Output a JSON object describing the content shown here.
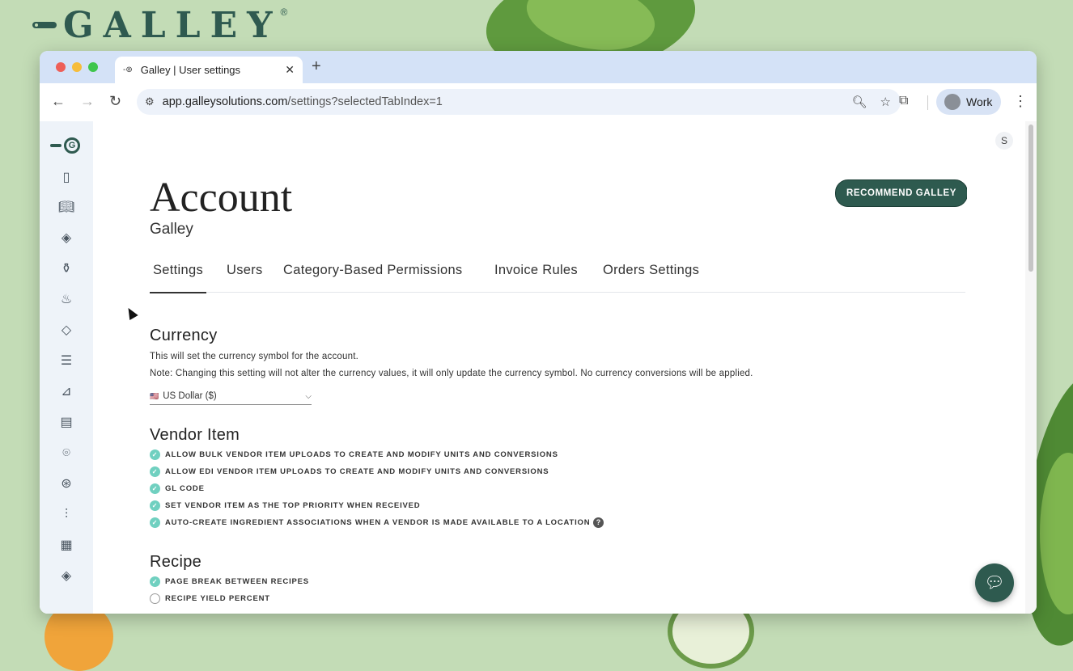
{
  "brand": {
    "name": "GALLEY",
    "reg": "®"
  },
  "browser": {
    "tab_title": "Galley | User settings",
    "url_host": "app.galleysolutions.com",
    "url_path": "/settings?selectedTabIndex=1",
    "profile_label": "Work"
  },
  "header": {
    "title": "Account",
    "subtitle": "Galley",
    "recommend_label": "RECOMMEND GALLEY",
    "user_initial": "S"
  },
  "tabs": [
    {
      "label": "Settings",
      "active": true
    },
    {
      "label": "Users"
    },
    {
      "label": "Category-Based Permissions"
    },
    {
      "label": "Invoice Rules"
    },
    {
      "label": "Orders Settings"
    }
  ],
  "currency": {
    "title": "Currency",
    "desc": "This will set the currency symbol for the account.",
    "note": "Note: Changing this setting will not alter the currency values, it will only update the currency symbol. No currency conversions will be applied.",
    "selected": "US Dollar ($)",
    "flag": "🇺🇸"
  },
  "vendor_item": {
    "title": "Vendor Item",
    "options": [
      {
        "label": "ALLOW BULK VENDOR ITEM UPLOADS TO CREATE AND MODIFY UNITS AND CONVERSIONS",
        "checked": true
      },
      {
        "label": "ALLOW EDI VENDOR ITEM UPLOADS TO CREATE AND MODIFY UNITS AND CONVERSIONS",
        "checked": true
      },
      {
        "label": "GL CODE",
        "checked": true
      },
      {
        "label": "SET VENDOR ITEM AS THE TOP PRIORITY WHEN RECEIVED",
        "checked": true
      },
      {
        "label": "AUTO-CREATE INGREDIENT ASSOCIATIONS WHEN A VENDOR IS MADE AVAILABLE TO A LOCATION",
        "checked": true,
        "help": "?"
      }
    ]
  },
  "recipe": {
    "title": "Recipe",
    "options": [
      {
        "label": "PAGE BREAK BETWEEN RECIPES",
        "checked": true
      },
      {
        "label": "RECIPE YIELD PERCENT",
        "checked": false
      }
    ]
  },
  "sidebar": {
    "icons": [
      "clipboard-icon",
      "book-icon",
      "leaf-icon",
      "bottle-icon",
      "chef-hat-icon",
      "tag-icon",
      "checklist-icon",
      "cart-icon",
      "document-icon",
      "location-icon",
      "dining-icon",
      "sliders-icon",
      "calendar-icon",
      "leaf-icon-2"
    ]
  },
  "colors": {
    "accent": "#2e5a4f",
    "check": "#70d0c0"
  }
}
